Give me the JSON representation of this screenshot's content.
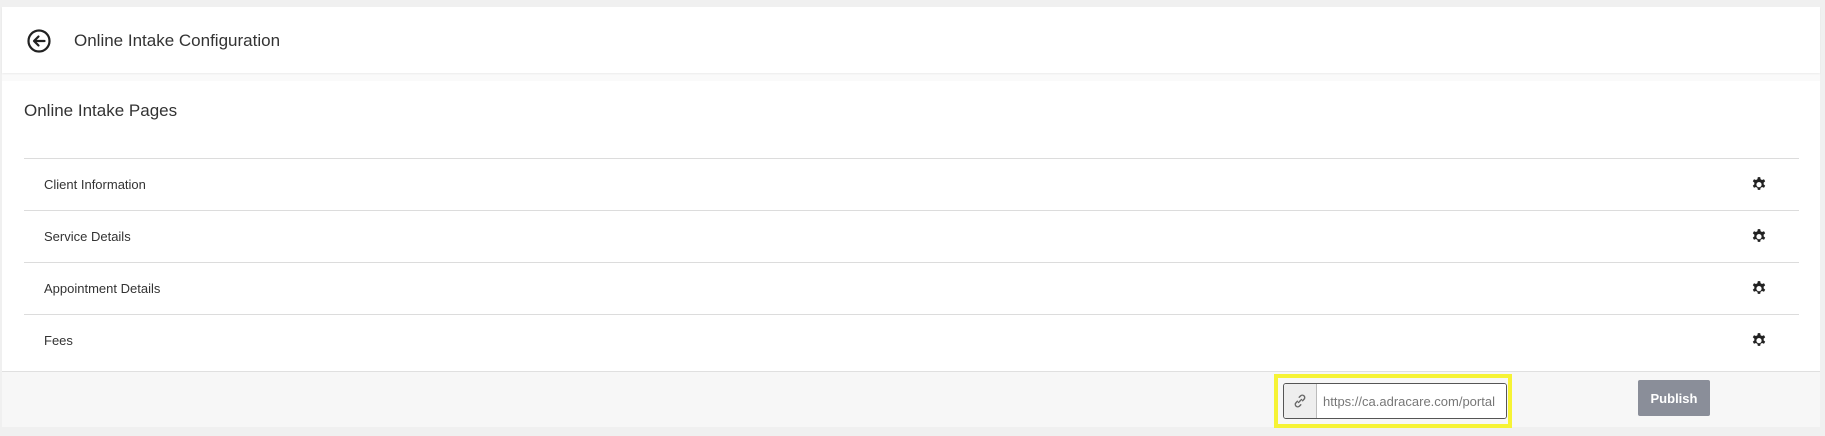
{
  "header": {
    "title": "Online Intake Configuration",
    "back_icon": "arrow-left-circle-icon"
  },
  "pages_card": {
    "title": "Online Intake Pages",
    "items": [
      {
        "label": "Client Information",
        "icon": "gear-icon"
      },
      {
        "label": "Service Details",
        "icon": "gear-icon"
      },
      {
        "label": "Appointment Details",
        "icon": "gear-icon"
      },
      {
        "label": "Fees",
        "icon": "gear-icon"
      }
    ]
  },
  "footer": {
    "url_value": "https://ca.adracare.com/portal",
    "link_icon": "link-icon",
    "publish_label": "Publish"
  },
  "colors": {
    "highlight": "#f6f335",
    "publish_bg": "#8a8e99"
  }
}
